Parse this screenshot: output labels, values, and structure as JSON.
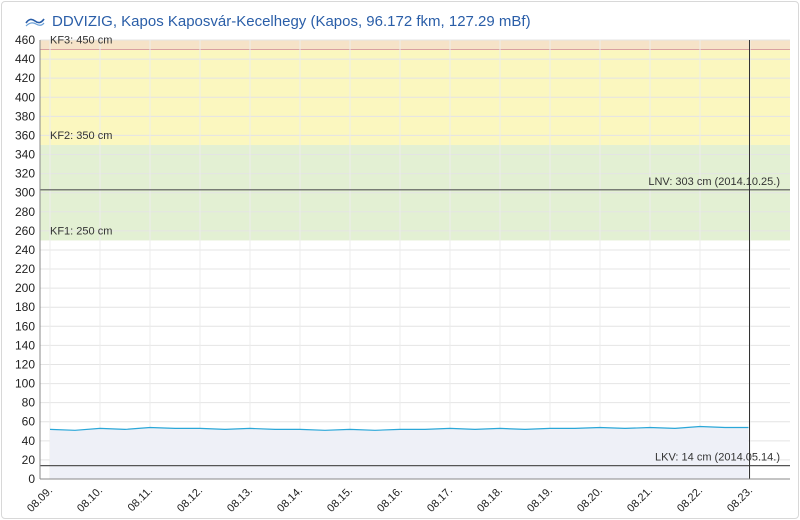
{
  "header": {
    "title": "DDVIZIG, Kapos Kaposvár-Kecelhegy (Kapos, 96.172 fkm, 127.29 mBf)",
    "logo_icon": "ddvizig-logo"
  },
  "chart_data": {
    "type": "line",
    "title": "DDVIZIG, Kapos Kaposvár-Kecelhegy (Kapos, 96.172 fkm, 127.29 mBf)",
    "ylim": [
      0,
      460
    ],
    "yticks": [
      0,
      20,
      40,
      60,
      80,
      100,
      120,
      140,
      160,
      180,
      200,
      220,
      240,
      260,
      280,
      300,
      320,
      340,
      360,
      380,
      400,
      420,
      440,
      460
    ],
    "categories": [
      "08.09.",
      "08.10.",
      "08.11.",
      "08.12.",
      "08.13.",
      "08.14.",
      "08.15.",
      "08.16.",
      "08.17.",
      "08.18.",
      "08.19.",
      "08.20.",
      "08.21.",
      "08.22.",
      "08.23."
    ],
    "grid": true,
    "bands": [
      {
        "label": "KF1: 250 cm",
        "from": 250,
        "to": 350,
        "color": "#e3f0d3"
      },
      {
        "label": "KF2: 350 cm",
        "from": 350,
        "to": 450,
        "color": "#fbf7bf"
      },
      {
        "label": "KF3: 450 cm",
        "from": 450,
        "to": 460,
        "color": "#f6e3c8"
      }
    ],
    "reference_lines": [
      {
        "label": "LNV: 303 cm (2014.10.25.)",
        "value": 303
      },
      {
        "label": "LKV: 14 cm (2014.05.14.)",
        "value": 14
      }
    ],
    "series": [
      {
        "color": "#2aa7d8",
        "x": [
          0,
          0.5,
          1,
          1.5,
          2,
          2.5,
          3,
          3.5,
          4,
          4.5,
          5,
          5.5,
          6,
          6.5,
          7,
          7.5,
          8,
          8.5,
          9,
          9.5,
          10,
          10.5,
          11,
          11.5,
          12,
          12.5,
          13,
          13.5,
          13.97
        ],
        "values": [
          52,
          51,
          53,
          52,
          54,
          53,
          53,
          52,
          53,
          52,
          52,
          51,
          52,
          51,
          52,
          52,
          53,
          52,
          53,
          52,
          53,
          53,
          54,
          53,
          54,
          53,
          55,
          54,
          54
        ]
      }
    ],
    "current_marker": "08.23."
  }
}
